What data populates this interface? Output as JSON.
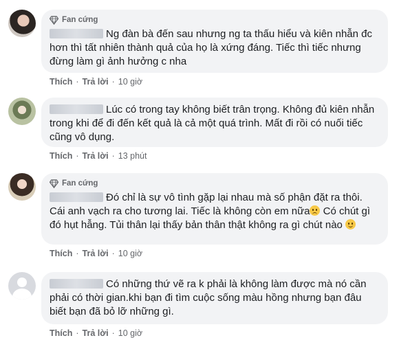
{
  "comments": [
    {
      "badge": "Fan cứng",
      "text": "Ng đàn bà đến sau nhưng ng ta thấu hiểu và kiên nhẫn đc hơn thì tất nhiên thành quả của họ là xứng đáng. Tiếc thì tiếc nhưng đừng làm gì ảnh hưởng c nha",
      "like": "Thích",
      "reply": "Trả lời",
      "time": "10 giờ"
    },
    {
      "text": "Lúc có trong tay không biết trân trọng. Không đủ kiên nhẫn trong khi để đi đến kết quả là cả một quá trình. Mất đi rồi có nuối tiếc cũng vô dụng.",
      "like": "Thích",
      "reply": "Trả lời",
      "time": "13 phút"
    },
    {
      "badge": "Fan cứng",
      "text_a": "Đó chỉ là sự vô tình gặp lại nhau mà số phận đặt ra thôi. Cái anh vạch ra cho tương lai. Tiếc là không còn em nữa",
      "text_b": "Có chút gì đó hụt hẫng. Tủi thân lại thấy bản thân thật không ra gì chút nào",
      "emoji_a": "sad-face-emoji",
      "emoji_b": "smile-emoji",
      "like": "Thích",
      "reply": "Trả lời",
      "time": "10 giờ"
    },
    {
      "text": "Có những thứ vẽ ra k phải là không làm được mà nó cần phải có thời gian.khi bạn đi tìm cuộc sống màu hồng nhưng bạn đâu biết bạn đã bỏ lỡ những gì.",
      "like": "Thích",
      "reply": "Trả lời",
      "time": "10 giờ"
    }
  ],
  "separator": "·",
  "colors": {
    "bubble": "#f2f3f5",
    "meta": "#65676b",
    "text": "#1c1e21"
  }
}
